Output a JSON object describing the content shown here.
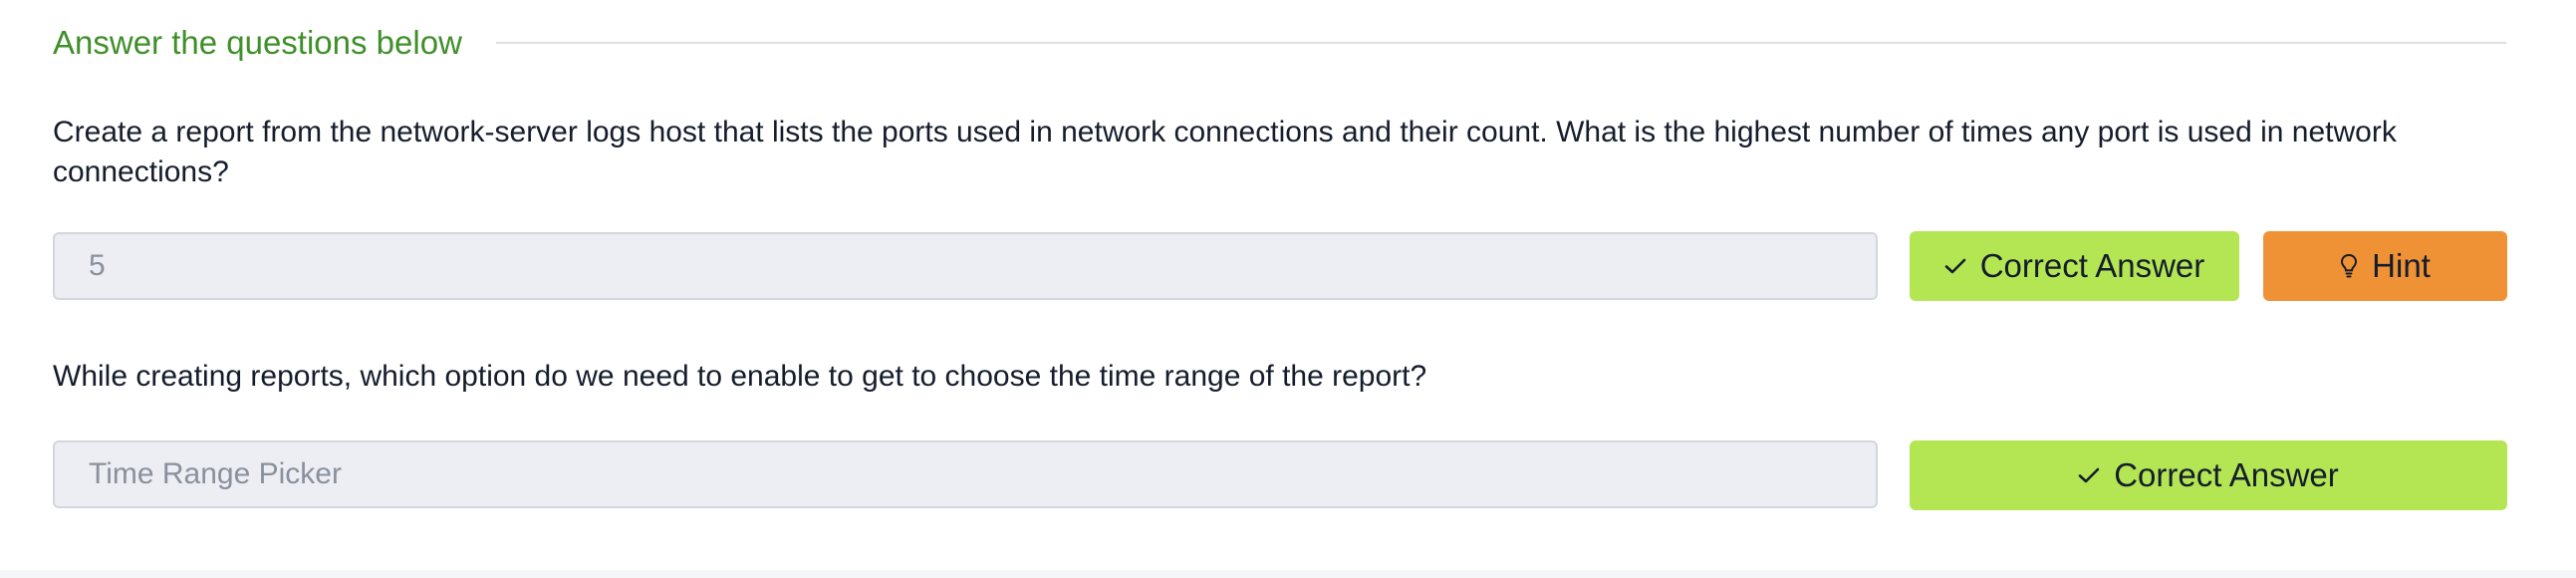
{
  "section": {
    "title": "Answer the questions below"
  },
  "questions": [
    {
      "text": "Create a report from the network-server logs host that lists the ports used in network connections and their count. What is the highest number of times any port is used in network connections?",
      "answer_value": "5",
      "submit_label": "Correct Answer",
      "submit_icon": "checkmark-icon",
      "hint_label": "Hint",
      "hint_icon": "lightbulb-icon"
    },
    {
      "text": "While creating reports, which option do we need to enable to get to choose the time range of the report?",
      "answer_value": "Time Range Picker",
      "submit_label": "Correct Answer",
      "submit_icon": "checkmark-icon"
    }
  ],
  "colors": {
    "title_green": "#3f8f2a",
    "correct_button": "#b4e654",
    "hint_button": "#ef9236",
    "field_background": "#eceef3"
  }
}
